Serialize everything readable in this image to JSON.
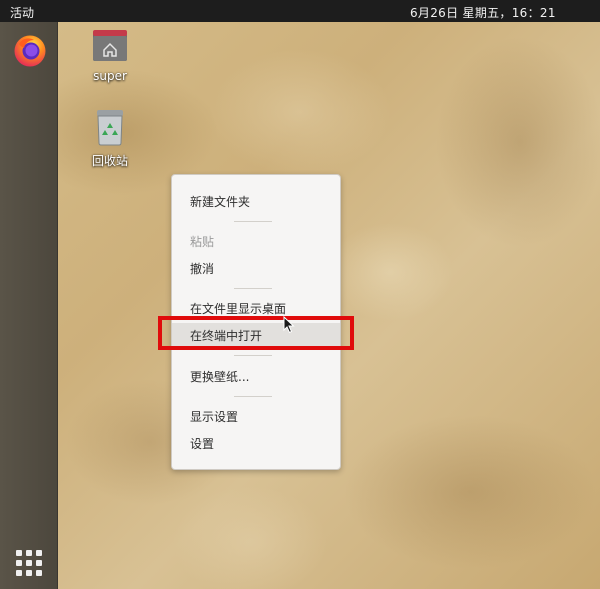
{
  "topbar": {
    "activities": "活动",
    "clock": "6月26日 星期五，16：21"
  },
  "dock": {
    "apps": [
      {
        "name": "Firefox",
        "icon": "firefox-icon"
      }
    ],
    "show_apps_icon": "app-grid-icon"
  },
  "desktop": {
    "icons": [
      {
        "label": "super",
        "icon": "home-folder-icon"
      },
      {
        "label": "回收站",
        "icon": "trash-icon"
      }
    ]
  },
  "context_menu": {
    "items": [
      {
        "label": "新建文件夹",
        "enabled": true
      },
      {
        "label": "粘贴",
        "enabled": false
      },
      {
        "label": "撤消",
        "enabled": true
      },
      {
        "label": "在文件里显示桌面",
        "enabled": true
      },
      {
        "label": "在终端中打开",
        "enabled": true,
        "hovered": true
      },
      {
        "label": "更换壁纸...",
        "enabled": true
      },
      {
        "label": "显示设置",
        "enabled": true
      },
      {
        "label": "设置",
        "enabled": true
      }
    ]
  },
  "colors": {
    "topbar": "#1d1d1d",
    "highlight": "#e00b0b",
    "menu_bg": "#f6f5f4"
  }
}
